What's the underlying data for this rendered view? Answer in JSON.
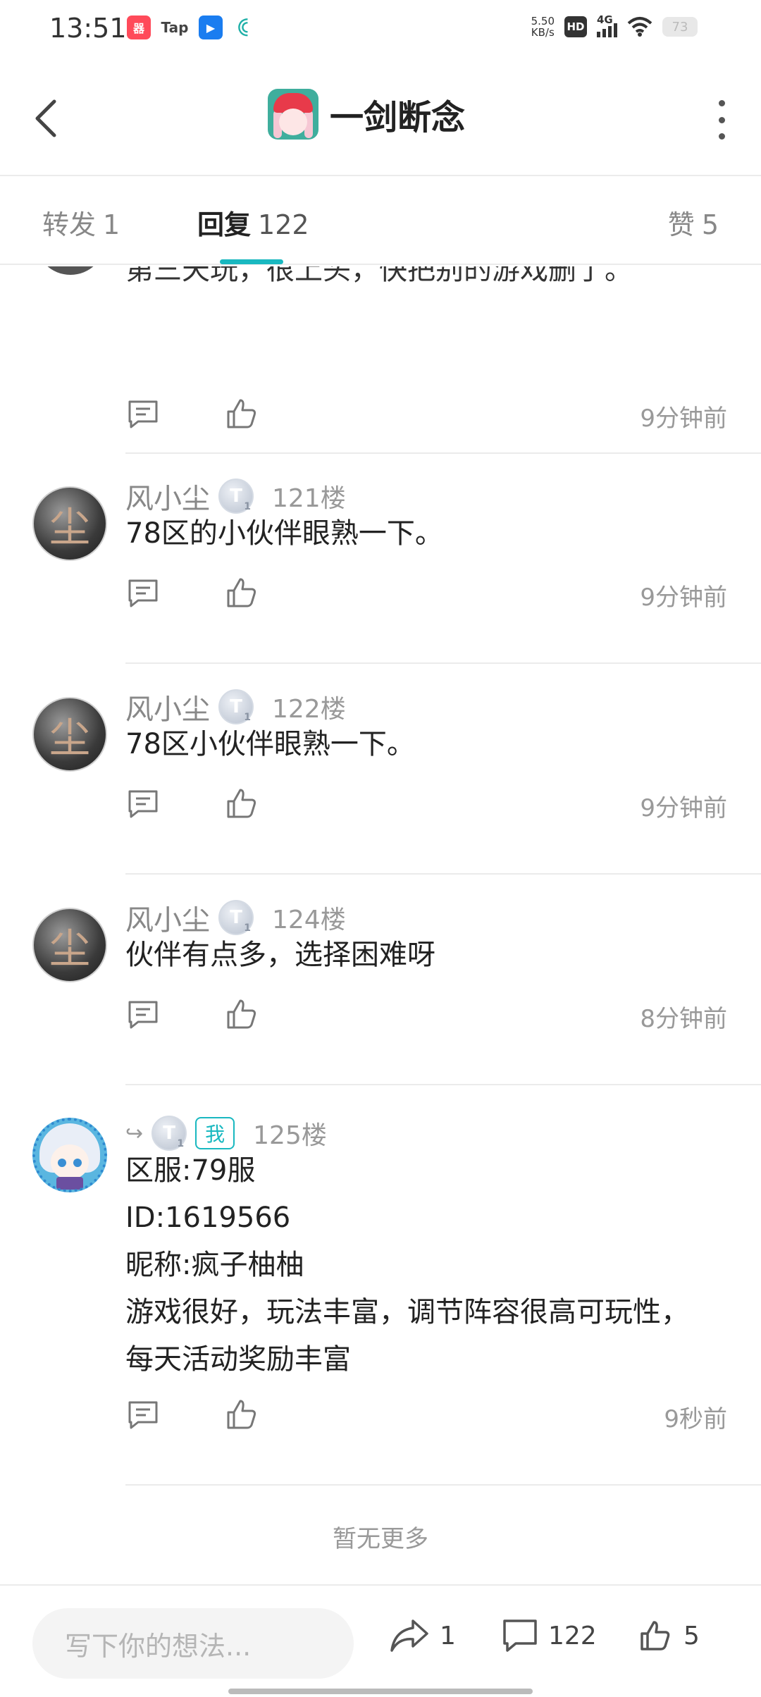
{
  "status_bar": {
    "time": "13:51",
    "apps": [
      {
        "icon": "app-red-icon",
        "glyph": "器"
      },
      {
        "icon": "taptap-icon",
        "glyph": "Tap"
      },
      {
        "icon": "blue-app-icon",
        "glyph": "▶"
      },
      {
        "icon": "carrier-icon",
        "glyph": "ꀯ"
      }
    ],
    "net_speed_value": "5.50",
    "net_speed_unit": "KB/s",
    "hd": "HD",
    "network": "4G",
    "battery": "73"
  },
  "header": {
    "title": "一剑断念"
  },
  "tabs": {
    "forward_label": "转发",
    "forward_count": "1",
    "reply_label": "回复",
    "reply_count": "122",
    "like_label": "赞",
    "like_count": "5"
  },
  "partial_post": {
    "text": "第三天玩，很上头，快把别的游戏删了。",
    "time": "9分钟前"
  },
  "posts": [
    {
      "user": "风小尘",
      "badge": "T",
      "badge_level": "1",
      "floor": "121楼",
      "lines": [
        "78区的小伙伴眼熟一下。"
      ],
      "time": "9分钟前"
    },
    {
      "user": "风小尘",
      "badge": "T",
      "badge_level": "1",
      "floor": "122楼",
      "lines": [
        "78区小伙伴眼熟一下。"
      ],
      "time": "9分钟前"
    },
    {
      "user": "风小尘",
      "badge": "T",
      "badge_level": "1",
      "floor": "124楼",
      "lines": [
        "伙伴有点多，选择困难呀"
      ],
      "time": "8分钟前"
    },
    {
      "user": "",
      "forward_glyph": "↪",
      "badge": "T",
      "badge_level": "1",
      "me_tag": "我",
      "floor": "125楼",
      "lines": [
        "区服:79服",
        "ID:1619566",
        "昵称:疯子柚柚",
        "游戏很好，玩法丰富，调节阵容很高可玩性，",
        "每天活动奖励丰富"
      ],
      "time": "9秒前"
    }
  ],
  "no_more": "暂无更多",
  "bottom_bar": {
    "input_placeholder": "写下你的想法...",
    "share_count": "1",
    "comment_count": "122",
    "like_count": "5"
  },
  "colors": {
    "accent": "#19b8c0",
    "muted_text": "#999999",
    "divider": "#ebebeb"
  }
}
